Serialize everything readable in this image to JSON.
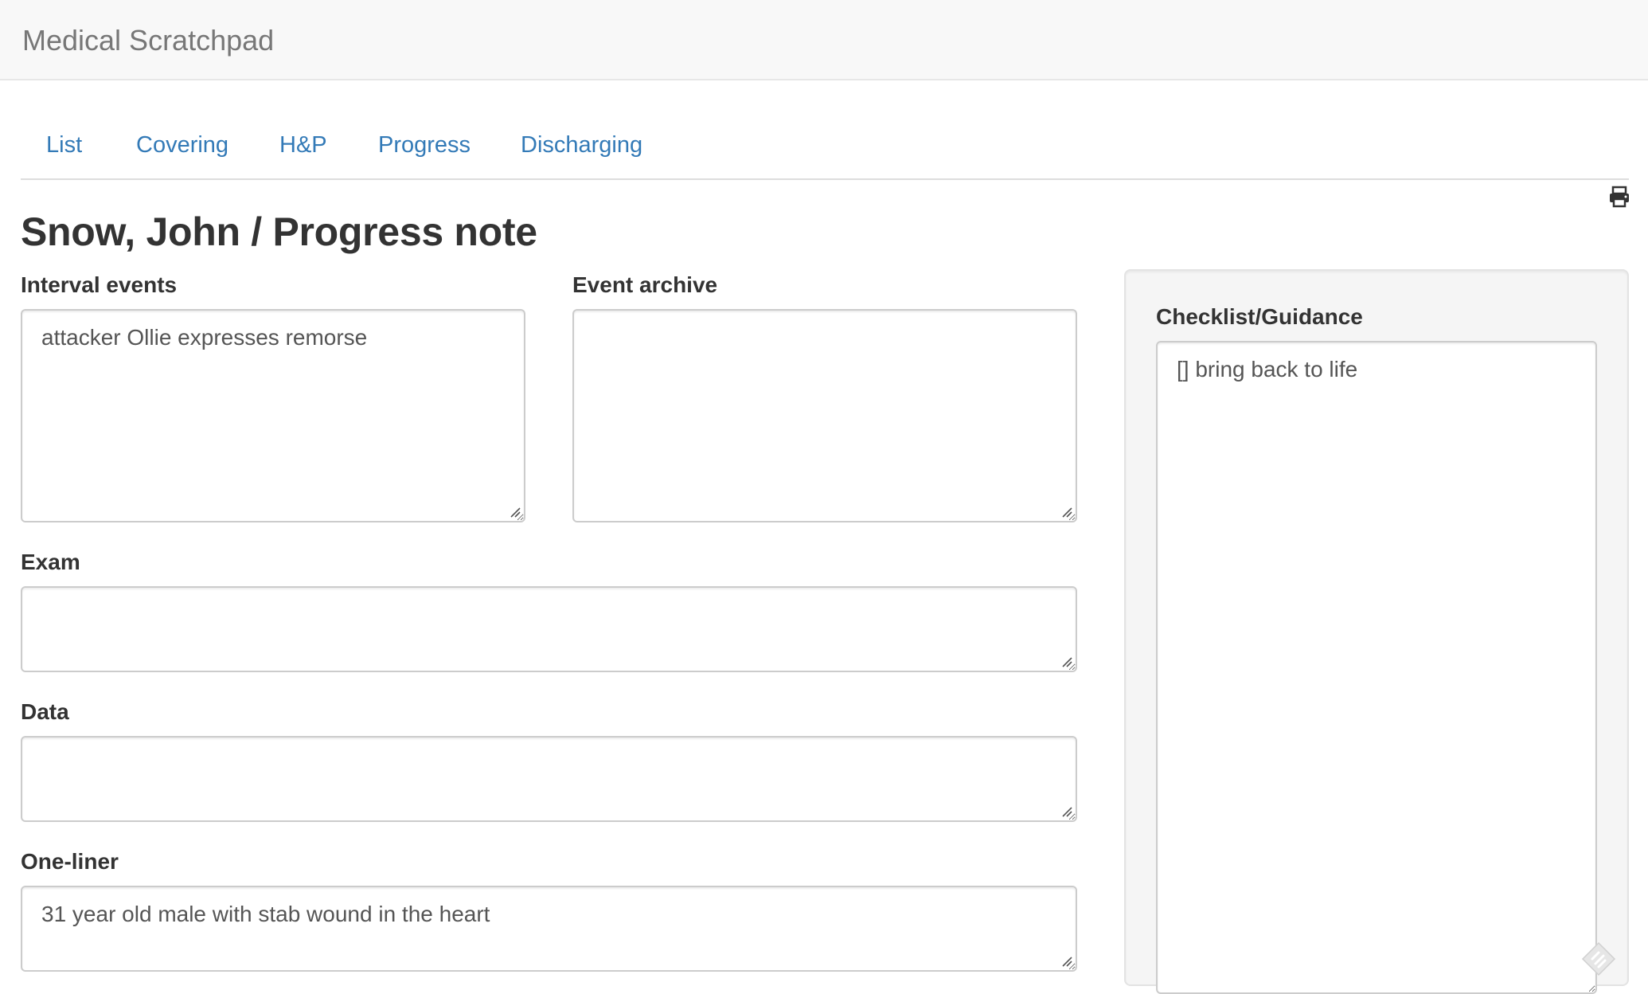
{
  "navbar": {
    "brand": "Medical Scratchpad"
  },
  "tabs": [
    {
      "label": "List"
    },
    {
      "label": "Covering"
    },
    {
      "label": "H&P"
    },
    {
      "label": "Progress"
    },
    {
      "label": "Discharging"
    }
  ],
  "colors": {
    "link": "#337ab7",
    "navbar_bg": "#f8f8f8",
    "sidebar_bg": "#f5f5f5"
  },
  "page": {
    "title": "Snow, John / Progress note"
  },
  "fields": {
    "interval_events": {
      "label": "Interval events",
      "value": "attacker Ollie expresses remorse"
    },
    "event_archive": {
      "label": "Event archive",
      "value": ""
    },
    "exam": {
      "label": "Exam",
      "value": ""
    },
    "data": {
      "label": "Data",
      "value": ""
    },
    "one_liner": {
      "label": "One-liner",
      "value": "31 year old male with stab wound in the heart"
    }
  },
  "sidebar": {
    "label": "Checklist/Guidance",
    "value": "[] bring back to life"
  },
  "icons": {
    "print": "print-icon",
    "grip": "resize-grip-icon",
    "badge": "floating-badge-icon"
  }
}
